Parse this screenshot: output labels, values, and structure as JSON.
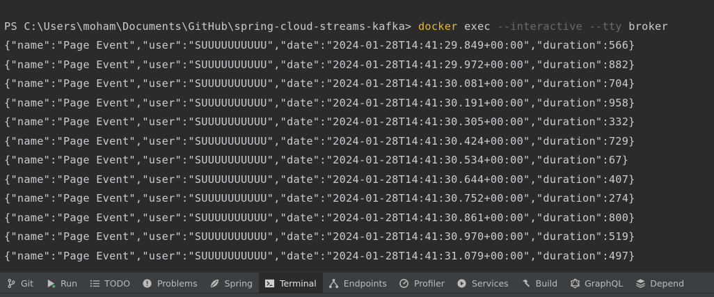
{
  "terminal": {
    "prompt": "PS C:\\Users\\moham\\Documents\\GitHub\\spring-cloud-streams-kafka>",
    "command": "docker",
    "subcommand": "exec",
    "flag_interactive": "--interactive",
    "flag_tty": "--tty",
    "container": "broker",
    "output": [
      "{\"name\":\"Page Event\",\"user\":\"SUUUUUUUUUU\",\"date\":\"2024-01-28T14:41:29.849+00:00\",\"duration\":566}",
      "{\"name\":\"Page Event\",\"user\":\"SUUUUUUUUUU\",\"date\":\"2024-01-28T14:41:29.972+00:00\",\"duration\":882}",
      "{\"name\":\"Page Event\",\"user\":\"SUUUUUUUUUU\",\"date\":\"2024-01-28T14:41:30.081+00:00\",\"duration\":704}",
      "{\"name\":\"Page Event\",\"user\":\"SUUUUUUUUUU\",\"date\":\"2024-01-28T14:41:30.191+00:00\",\"duration\":958}",
      "{\"name\":\"Page Event\",\"user\":\"SUUUUUUUUUU\",\"date\":\"2024-01-28T14:41:30.305+00:00\",\"duration\":332}",
      "{\"name\":\"Page Event\",\"user\":\"SUUUUUUUUUU\",\"date\":\"2024-01-28T14:41:30.424+00:00\",\"duration\":729}",
      "{\"name\":\"Page Event\",\"user\":\"SUUUUUUUUUU\",\"date\":\"2024-01-28T14:41:30.534+00:00\",\"duration\":67}",
      "{\"name\":\"Page Event\",\"user\":\"SUUUUUUUUUU\",\"date\":\"2024-01-28T14:41:30.644+00:00\",\"duration\":407}",
      "{\"name\":\"Page Event\",\"user\":\"SUUUUUUUUUU\",\"date\":\"2024-01-28T14:41:30.752+00:00\",\"duration\":274}",
      "{\"name\":\"Page Event\",\"user\":\"SUUUUUUUUUU\",\"date\":\"2024-01-28T14:41:30.861+00:00\",\"duration\":800}",
      "{\"name\":\"Page Event\",\"user\":\"SUUUUUUUUUU\",\"date\":\"2024-01-28T14:41:30.970+00:00\",\"duration\":519}",
      "{\"name\":\"Page Event\",\"user\":\"SUUUUUUUUUU\",\"date\":\"2024-01-28T14:41:31.079+00:00\",\"duration\":497}"
    ]
  },
  "toolbar": {
    "items": [
      {
        "label": "Git",
        "icon": "git-branch-icon"
      },
      {
        "label": "Run",
        "icon": "run-icon"
      },
      {
        "label": "TODO",
        "icon": "todo-list-icon"
      },
      {
        "label": "Problems",
        "icon": "problems-icon"
      },
      {
        "label": "Spring",
        "icon": "spring-leaf-icon"
      },
      {
        "label": "Terminal",
        "icon": "terminal-icon"
      },
      {
        "label": "Endpoints",
        "icon": "endpoints-icon"
      },
      {
        "label": "Profiler",
        "icon": "profiler-icon"
      },
      {
        "label": "Services",
        "icon": "services-icon"
      },
      {
        "label": "Build",
        "icon": "build-hammer-icon"
      },
      {
        "label": "GraphQL",
        "icon": "graphql-icon"
      },
      {
        "label": "Depend",
        "icon": "dependencies-icon"
      }
    ],
    "active": "Terminal"
  },
  "colors": {
    "background": "#2b2b2b",
    "text": "#c9ccd1",
    "command": "#e5b92a",
    "flag": "#6b6b6b",
    "toolbar_bg": "#3c3f41"
  }
}
